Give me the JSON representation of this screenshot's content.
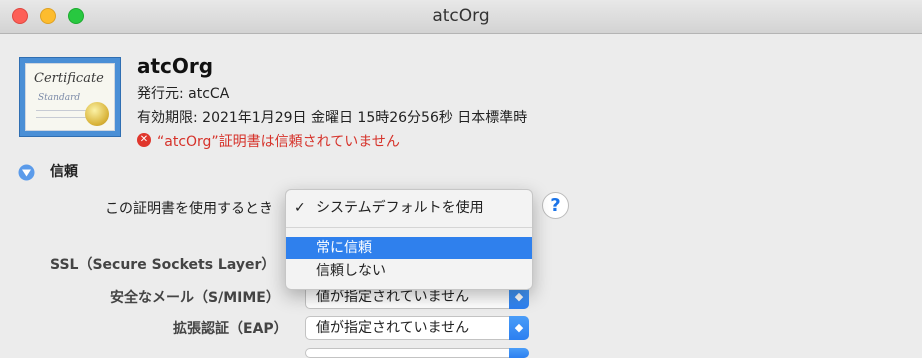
{
  "window": {
    "title": "atcOrg"
  },
  "certificate": {
    "name": "atcOrg",
    "issuer": "発行元: atcCA",
    "expiry": "有効期限: 2021年1月29日 金曜日 15時26分56秒 日本標準時",
    "warning": "“atcOrg”証明書は信頼されていません",
    "warning_color": "#d6322a",
    "image_text": {
      "line1": "Certificate",
      "line2": "Standard"
    }
  },
  "trust": {
    "section_label": "信頼",
    "when_using_label": "この証明書を使用するとき",
    "rows": [
      {
        "label": "SSL（Secure Sockets Layer）",
        "value": ""
      },
      {
        "label": "安全なメール（S/MIME）",
        "value": "値が指定されていません"
      },
      {
        "label": "拡張認証（EAP）",
        "value": "値が指定されていません"
      }
    ],
    "help_label": "?"
  },
  "dropdown": {
    "options": [
      {
        "label": "システムデフォルトを使用",
        "checked": true
      },
      {
        "label": "常に信頼",
        "highlighted": true
      },
      {
        "label": "信頼しない"
      }
    ],
    "check_mark": "✓"
  },
  "colors": {
    "accent": "#2f80ed",
    "error": "#e0362c"
  }
}
